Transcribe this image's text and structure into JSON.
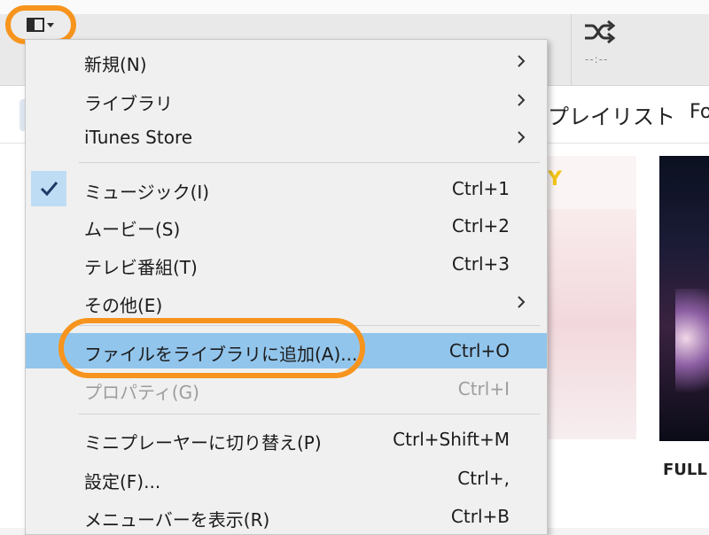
{
  "menu_button": {
    "icon": "sidebar-menu-icon"
  },
  "player": {
    "shuffle_icon": "shuffle-icon",
    "time_text": "--:--"
  },
  "tabs": {
    "playlist": "プレイリスト",
    "for_you_partial": "Fo"
  },
  "content": {
    "card_1_letter": "Y",
    "card_1_caption": "Y",
    "card_2_caption": "FULL"
  },
  "menu": {
    "items": [
      {
        "label": "新規(N)",
        "shortcut": "",
        "submenu": true,
        "checked": false,
        "highlighted": false,
        "disabled": false
      },
      {
        "label": "ライブラリ",
        "shortcut": "",
        "submenu": true,
        "checked": false,
        "highlighted": false,
        "disabled": false
      },
      {
        "label": "iTunes Store",
        "shortcut": "",
        "submenu": true,
        "checked": false,
        "highlighted": false,
        "disabled": false
      },
      {
        "label": "ミュージック(I)",
        "shortcut": "Ctrl+1",
        "submenu": false,
        "checked": true,
        "highlighted": false,
        "disabled": false
      },
      {
        "label": "ムービー(S)",
        "shortcut": "Ctrl+2",
        "submenu": false,
        "checked": false,
        "highlighted": false,
        "disabled": false
      },
      {
        "label": "テレビ番組(T)",
        "shortcut": "Ctrl+3",
        "submenu": false,
        "checked": false,
        "highlighted": false,
        "disabled": false
      },
      {
        "label": "その他(E)",
        "shortcut": "",
        "submenu": true,
        "checked": false,
        "highlighted": false,
        "disabled": false
      },
      {
        "label": "ファイルをライブラリに追加(A)...",
        "shortcut": "Ctrl+O",
        "submenu": false,
        "checked": false,
        "highlighted": true,
        "disabled": false
      },
      {
        "label": "プロパティ(G)",
        "shortcut": "Ctrl+I",
        "submenu": false,
        "checked": false,
        "highlighted": false,
        "disabled": true
      },
      {
        "label": "ミニプレーヤーに切り替え(P)",
        "shortcut": "Ctrl+Shift+M",
        "submenu": false,
        "checked": false,
        "highlighted": false,
        "disabled": false
      },
      {
        "label": "設定(F)...",
        "shortcut": "Ctrl+,",
        "submenu": false,
        "checked": false,
        "highlighted": false,
        "disabled": false
      },
      {
        "label": "メニューバーを表示(R)",
        "shortcut": "Ctrl+B",
        "submenu": false,
        "checked": false,
        "highlighted": false,
        "disabled": false
      }
    ]
  },
  "colors": {
    "annotation_orange": "#f7941d",
    "highlight_blue": "#92c5ec",
    "check_background": "#bfdcf5",
    "menu_background": "#f0f0f0",
    "disabled_text": "#9d9d9d"
  }
}
